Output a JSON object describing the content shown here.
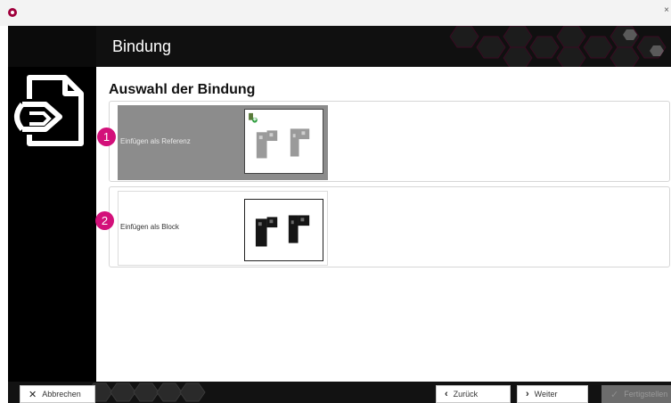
{
  "window": {
    "close_glyph": "×"
  },
  "header": {
    "title": "Bindung"
  },
  "content": {
    "section_title": "Auswahl der Bindung",
    "options": [
      {
        "label": "Einfügen als Referenz",
        "badge": "1",
        "selected": true
      },
      {
        "label": "Einfügen als Block",
        "badge": "2",
        "selected": false
      }
    ]
  },
  "footer": {
    "cancel_label": "Abbrechen",
    "back_label": "Zurück",
    "next_label": "Weiter",
    "finish_label": "Fertigstellen"
  },
  "icons": {
    "app": "app-icon",
    "logo": "document-link-icon",
    "cancel": "close-icon",
    "back": "chevron-left-icon",
    "next": "chevron-right-icon",
    "finish": "checkmark-icon",
    "reference": "link-icon"
  },
  "colors": {
    "accent": "#d3107a",
    "frame": "#0b0b0b",
    "selected_option": "#8c8c8c"
  }
}
